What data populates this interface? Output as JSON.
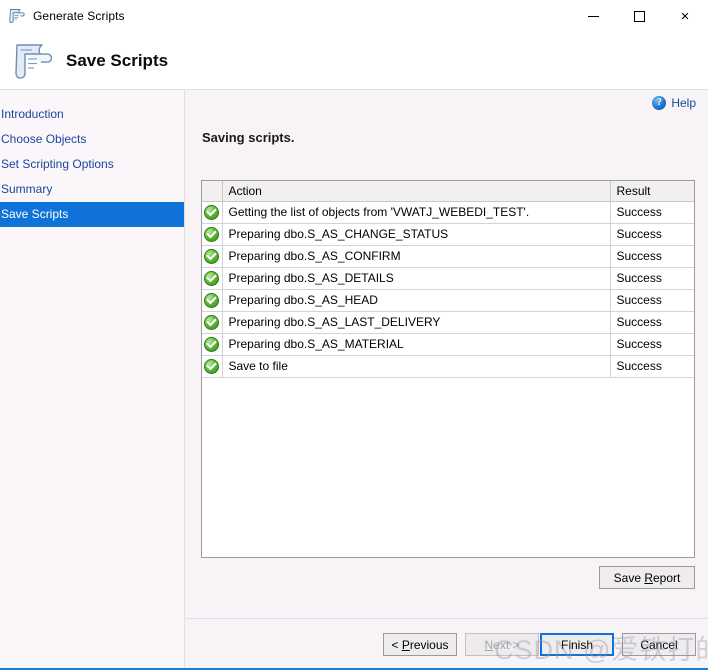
{
  "window": {
    "title": "Generate Scripts",
    "icon": "script-scroll-icon",
    "controls": {
      "minimize": "—",
      "maximize": "□",
      "close": "×"
    }
  },
  "banner": {
    "title": "Save Scripts",
    "icon": "script-scroll-large-icon"
  },
  "sidebar": {
    "items": [
      {
        "label": "Introduction",
        "selected": false
      },
      {
        "label": "Choose Objects",
        "selected": false
      },
      {
        "label": "Set Scripting Options",
        "selected": false
      },
      {
        "label": "Summary",
        "selected": false
      },
      {
        "label": "Save Scripts",
        "selected": true
      }
    ]
  },
  "main": {
    "help_label": "Help",
    "help_icon_glyph": "?",
    "section_title": "Saving scripts.",
    "grid": {
      "columns": [
        "",
        "Action",
        "Result"
      ],
      "rows": [
        {
          "status": "success",
          "action": "Getting the list of objects from 'VWATJ_WEBEDI_TEST'.",
          "result": "Success"
        },
        {
          "status": "success",
          "action": "Preparing dbo.S_AS_CHANGE_STATUS",
          "result": "Success"
        },
        {
          "status": "success",
          "action": "Preparing dbo.S_AS_CONFIRM",
          "result": "Success"
        },
        {
          "status": "success",
          "action": "Preparing dbo.S_AS_DETAILS",
          "result": "Success"
        },
        {
          "status": "success",
          "action": "Preparing dbo.S_AS_HEAD",
          "result": "Success"
        },
        {
          "status": "success",
          "action": "Preparing dbo.S_AS_LAST_DELIVERY",
          "result": "Success"
        },
        {
          "status": "success",
          "action": "Preparing dbo.S_AS_MATERIAL",
          "result": "Success"
        },
        {
          "status": "success",
          "action": "Save to file",
          "result": "Success"
        }
      ]
    },
    "save_report_label": "Save Report"
  },
  "footer": {
    "previous_label": "< Previous",
    "next_label": "Next >",
    "finish_label": "Finish",
    "cancel_label": "Cancel"
  },
  "watermark": {
    "text": "CSDN @爱铁打的阿秀"
  },
  "colors": {
    "accent": "#0f72d8",
    "link": "#18479b",
    "success": "#63bb3b",
    "window_bg": "#f7f3f7"
  }
}
